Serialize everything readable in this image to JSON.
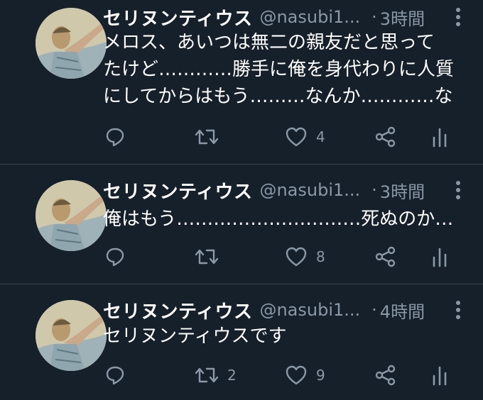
{
  "tweets": [
    {
      "name": "セリヌンティウス",
      "handle": "@nasubi1...",
      "dot": "·",
      "time": "3時間",
      "text_lines": [
        "メロス、あいつは無二の親友だと思って",
        "たけど…………勝手に俺を身代わりに人質",
        "にしてからはもう………なんか…………な"
      ],
      "reply_icon": "reply-icon",
      "retweet_icon": "retweet-icon",
      "like_icon": "heart-icon",
      "share_icon": "share-icon",
      "analytics_icon": "analytics-icon",
      "reply_count": "",
      "retweet_count": "",
      "like_count": "4"
    },
    {
      "name": "セリヌンティウス",
      "handle": "@nasubi1...",
      "dot": "·",
      "time": "3時間",
      "text_lines": [
        "俺はもう…………………………死ぬのか…"
      ],
      "reply_icon": "reply-icon",
      "retweet_icon": "retweet-icon",
      "like_icon": "heart-icon",
      "share_icon": "share-icon",
      "analytics_icon": "analytics-icon",
      "reply_count": "",
      "retweet_count": "",
      "like_count": "8"
    },
    {
      "name": "セリヌンティウス",
      "handle": "@nasubi1...",
      "dot": "·",
      "time": "4時間",
      "text_lines": [
        "セリヌンティウスです"
      ],
      "reply_icon": "reply-icon",
      "retweet_icon": "retweet-icon",
      "like_icon": "heart-icon",
      "share_icon": "share-icon",
      "analytics_icon": "analytics-icon",
      "reply_count": "",
      "retweet_count": "2",
      "like_count": "9"
    }
  ],
  "colors": {
    "background": "#15202b",
    "text": "#ffffff",
    "secondary": "#8b98a5",
    "divider": "#38444d"
  }
}
